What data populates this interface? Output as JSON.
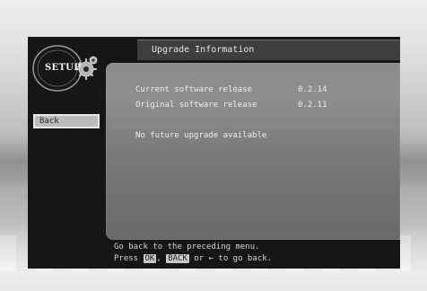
{
  "menu": {
    "logo_label": "SETUP",
    "back_label": "Back"
  },
  "header": {
    "title": "Upgrade Information"
  },
  "info": {
    "current_label": "Current software release",
    "current_value": "0.2.14",
    "original_label": "Original software release",
    "original_value": "0.2.11",
    "status": "No future upgrade available"
  },
  "help": {
    "line1": "Go back to the preceding menu.",
    "press": "Press",
    "ok_key": "OK",
    "separator": ",",
    "back_key": "BACK",
    "or_text": "or",
    "arrow_key": "←",
    "tail": "to go back."
  }
}
